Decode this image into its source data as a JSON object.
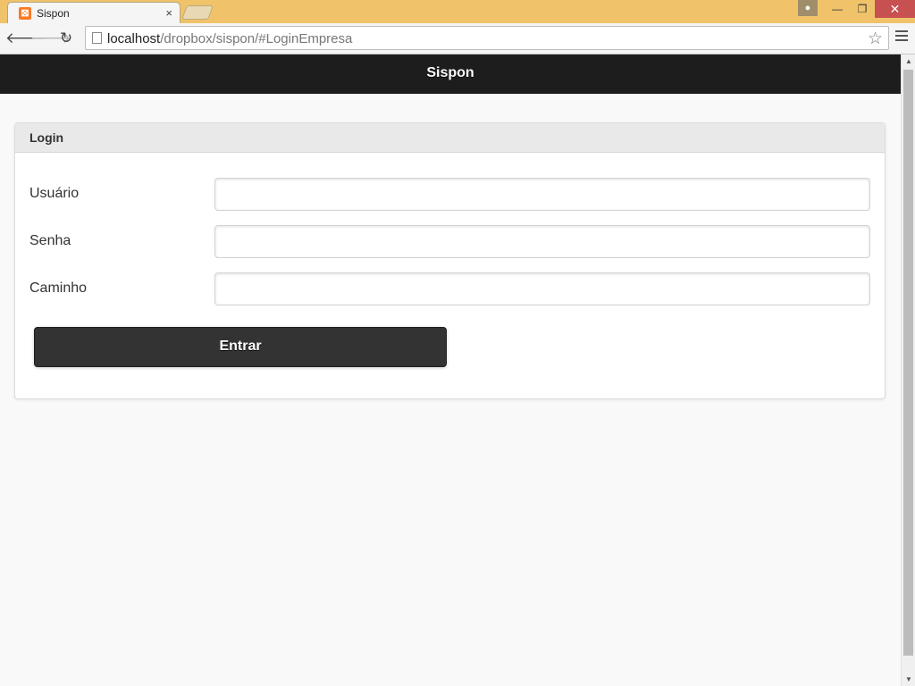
{
  "browser": {
    "tab_title": "Sispon",
    "favicon_glyph": "⊠",
    "close_glyph": "×",
    "url_host": "localhost",
    "url_path": "/dropbox/sispon/#LoginEmpresa",
    "window_buttons": {
      "minimize": "—",
      "restore": "❐",
      "close": "✕"
    }
  },
  "app": {
    "header_title": "Sispon"
  },
  "login": {
    "panel_title": "Login",
    "fields": [
      {
        "label": "Usuário",
        "value": ""
      },
      {
        "label": "Senha",
        "value": ""
      },
      {
        "label": "Caminho",
        "value": ""
      }
    ],
    "submit_label": "Entrar"
  },
  "colors": {
    "header_bg": "#1d1d1d",
    "button_bg": "#333333",
    "page_bg": "#f9f9f9",
    "titlebar_bg": "#f0c36a",
    "close_button_bg": "#c75050"
  }
}
